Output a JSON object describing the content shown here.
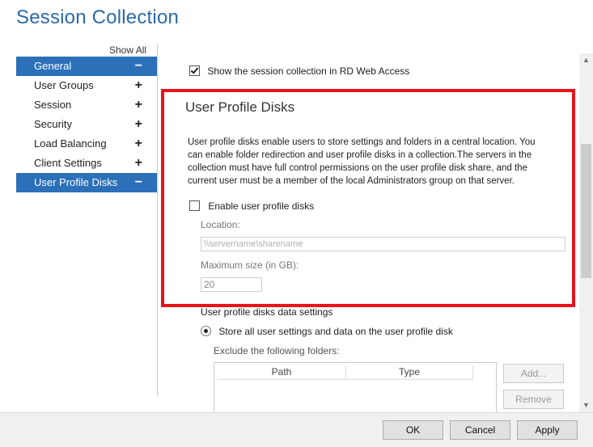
{
  "window": {
    "title": "Session Collection"
  },
  "sidebar": {
    "show_all": "Show All",
    "items": [
      {
        "label": "General",
        "sign": "−",
        "active": true
      },
      {
        "label": "User Groups",
        "sign": "+",
        "active": false
      },
      {
        "label": "Session",
        "sign": "+",
        "active": false
      },
      {
        "label": "Security",
        "sign": "+",
        "active": false
      },
      {
        "label": "Load Balancing",
        "sign": "+",
        "active": false
      },
      {
        "label": "Client Settings",
        "sign": "+",
        "active": false
      },
      {
        "label": "User Profile Disks",
        "sign": "−",
        "active": true
      }
    ]
  },
  "general": {
    "show_in_web_access": {
      "label": "Show the session collection in RD Web Access",
      "checked": true
    }
  },
  "upd": {
    "title": "User Profile Disks",
    "description": "User profile disks enable users to store settings and folders in a central location. You can enable folder redirection and user profile disks in a collection.The servers in the collection must have full control permissions on the user profile disk share, and the current user must be a member of the local Administrators group on that server.",
    "enable": {
      "label": "Enable user profile disks",
      "checked": false
    },
    "location_label": "Location:",
    "location_placeholder": "\\\\servername\\sharename",
    "max_size_label": "Maximum size (in GB):",
    "max_size_value": "20",
    "data_settings_label": "User profile disks data settings",
    "store_all_label": "Store all user settings and data on the user profile disk",
    "exclude_label": "Exclude the following folders:",
    "table_headers": [
      "Path",
      "Type"
    ],
    "add_label": "Add...",
    "remove_label": "Remove"
  },
  "footer": {
    "ok": "OK",
    "cancel": "Cancel",
    "apply": "Apply"
  },
  "colors": {
    "accent": "#2b70b8",
    "title": "#2c6aa6",
    "highlight": "#e8141b"
  },
  "icons": {
    "scroll_up": "scroll-up-arrow",
    "scroll_down": "scroll-down-arrow"
  }
}
